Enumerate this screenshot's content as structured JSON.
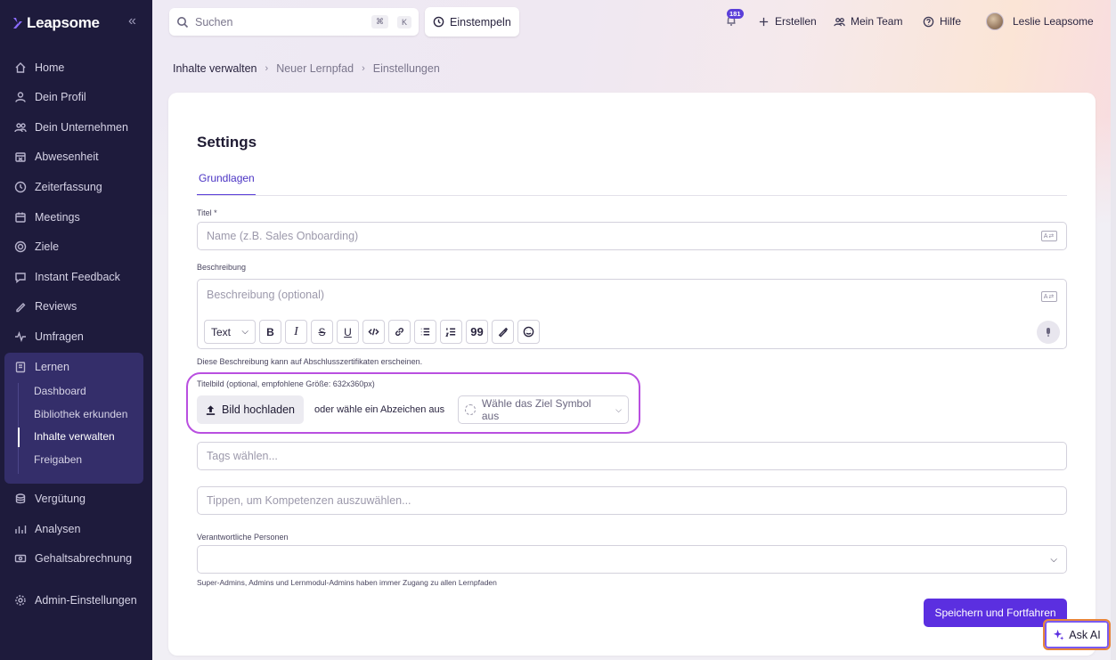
{
  "brand": {
    "name": "Leapsome"
  },
  "sidebar": {
    "items": [
      {
        "label": "Home",
        "icon": "home-icon"
      },
      {
        "label": "Dein Profil",
        "icon": "user-icon"
      },
      {
        "label": "Dein Unternehmen",
        "icon": "users-icon"
      },
      {
        "label": "Abwesenheit",
        "icon": "calendar-x-icon"
      },
      {
        "label": "Zeiterfassung",
        "icon": "clock-icon"
      },
      {
        "label": "Meetings",
        "icon": "calendar-icon"
      },
      {
        "label": "Ziele",
        "icon": "target-icon"
      },
      {
        "label": "Instant Feedback",
        "icon": "chat-icon"
      },
      {
        "label": "Reviews",
        "icon": "pen-icon"
      },
      {
        "label": "Umfragen",
        "icon": "pulse-icon"
      },
      {
        "label": "Lernen",
        "icon": "book-icon"
      },
      {
        "label": "Vergütung",
        "icon": "coins-icon"
      },
      {
        "label": "Analysen",
        "icon": "chart-icon"
      },
      {
        "label": "Gehaltsabrechnung",
        "icon": "money-icon"
      },
      {
        "label": "Admin-Einstellungen",
        "icon": "gear-icon"
      }
    ],
    "learn_sub": [
      "Dashboard",
      "Bibliothek erkunden",
      "Inhalte verwalten",
      "Freigaben"
    ],
    "active_sub": "Inhalte verwalten"
  },
  "topbar": {
    "search_placeholder": "Suchen",
    "shortcut_1": "⌘",
    "shortcut_2": "K",
    "stamp_label": "Einstempeln",
    "notification_count": "181",
    "create_label": "Erstellen",
    "team_label": "Mein Team",
    "help_label": "Hilfe",
    "user_name": "Leslie Leapsome"
  },
  "breadcrumb": [
    "Inhalte verwalten",
    "Neuer Lernpfad",
    "Einstellungen"
  ],
  "page": {
    "title": "Settings",
    "tab": "Grundlagen",
    "title_label": "Titel *",
    "title_placeholder": "Name (z.B. Sales Onboarding)",
    "desc_label": "Beschreibung",
    "desc_placeholder": "Beschreibung (optional)",
    "toolbar_text_select": "Text",
    "desc_helper": "Diese Beschreibung kann auf Abschlusszertifikaten erscheinen.",
    "image_label": "Titelbild (optional, empfohlene Größe: 632x360px)",
    "upload_label": "Bild hochladen",
    "or_text": "oder wähle ein Abzeichen aus",
    "goal_symbol_placeholder": "Wähle das Ziel Symbol aus",
    "tags_placeholder": "Tags wählen...",
    "skills_placeholder": "Tippen, um Kompetenzen auszuwählen...",
    "responsible_label": "Verantwortliche Personen",
    "responsible_note": "Super-Admins, Admins und Lernmodul-Admins haben immer Zugang zu allen Lernpfaden",
    "save_label": "Speichern und Fortfahren",
    "ask_ai_label": "Ask AI"
  },
  "colors": {
    "accent": "#5b2fe0",
    "sidebar_bg": "#1e1b3c",
    "highlight": "#b94fe0"
  }
}
